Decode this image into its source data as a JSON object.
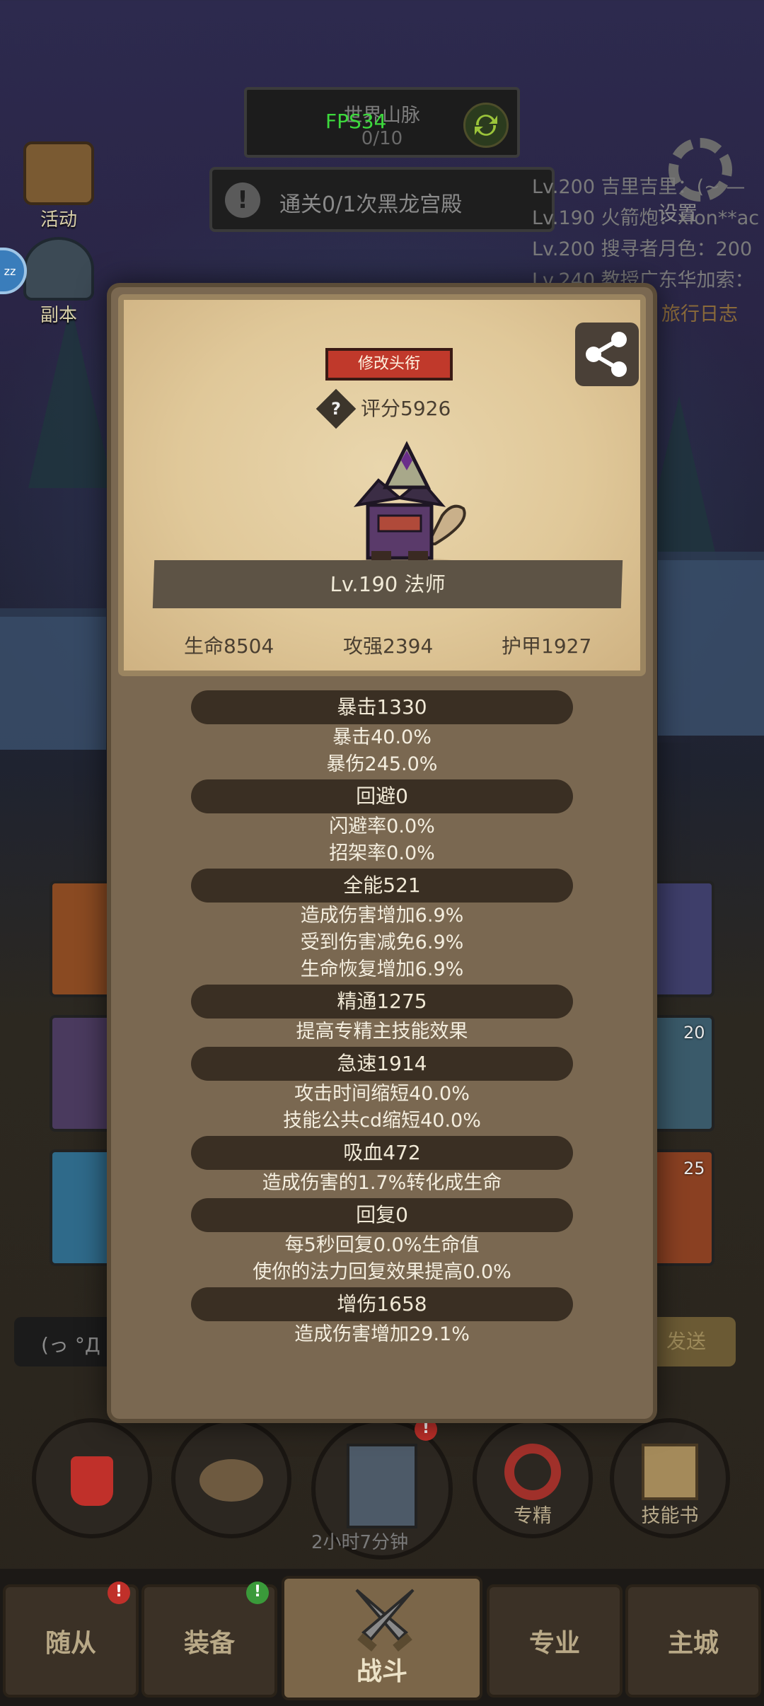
{
  "fps": "FPS34",
  "quest": {
    "title": "世界山脉",
    "count": "0/10"
  },
  "dungeon_task": {
    "icon_text": "!",
    "text": "通关0/1次黑龙宫殿"
  },
  "side_menu": {
    "activity": "活动",
    "dungeon": "副本"
  },
  "chat_preview": [
    "Lv.200 吉里吉里：(~ —",
    "Lv.190 火箭炮：xion**ac",
    "Lv.200 搜寻者月色：200",
    "Lv.240 教授广东华加索："
  ],
  "settings_label": "设置",
  "travel_log_label": "旅行日志",
  "zz_badge": "zz",
  "bg_slot_numbers": {
    "slot_a": "20",
    "slot_b": "25"
  },
  "chat_input_text": "(っ °Д",
  "send_label": "发送",
  "bottom_actions": {
    "timer": "2小时7分钟",
    "specialization": "专精",
    "skill_book": "技能书"
  },
  "tabs": [
    {
      "label": "随从",
      "badge": "!"
    },
    {
      "label": "装备",
      "badge": "!"
    },
    {
      "label": "战斗"
    },
    {
      "label": "专业"
    },
    {
      "label": "主城"
    }
  ],
  "character": {
    "edit_title_label": "修改头衔",
    "help_icon": "?",
    "score": "评分5926",
    "level_class": "Lv.190 法师",
    "hp": "生命8504",
    "attack": "攻强2394",
    "armor": "护甲1927"
  },
  "stat_groups": [
    {
      "header": "暴击1330",
      "lines": [
        "暴击40.0%",
        "暴伤245.0%"
      ]
    },
    {
      "header": "回避0",
      "lines": [
        "闪避率0.0%",
        "招架率0.0%"
      ]
    },
    {
      "header": "全能521",
      "lines": [
        "造成伤害增加6.9%",
        "受到伤害减免6.9%",
        "生命恢复增加6.9%"
      ]
    },
    {
      "header": "精通1275",
      "lines": [
        "提高专精主技能效果"
      ]
    },
    {
      "header": "急速1914",
      "lines": [
        "攻击时间缩短40.0%",
        "技能公共cd缩短40.0%"
      ]
    },
    {
      "header": "吸血472",
      "lines": [
        "造成伤害的1.7%转化成生命"
      ]
    },
    {
      "header": "回复0",
      "lines": [
        "每5秒回复0.0%生命值",
        "使你的法力回复效果提高0.0%"
      ]
    },
    {
      "header": "增伤1658",
      "lines": [
        "造成伤害增加29.1%"
      ]
    }
  ],
  "colors": {
    "modal_bg": "#7a6851",
    "card_bg": "#e0c899",
    "title_btn": "#c0392b",
    "stat_header": "#3a2f23",
    "fps": "#3cd93c"
  },
  "icons": [
    "refresh-icon",
    "exclamation-icon",
    "activity-icon",
    "dungeon-icon",
    "gear-icon",
    "share-icon",
    "help-icon",
    "potion-icon",
    "bread-icon",
    "chest-icon",
    "target-icon",
    "book-icon",
    "crossed-swords-icon"
  ]
}
